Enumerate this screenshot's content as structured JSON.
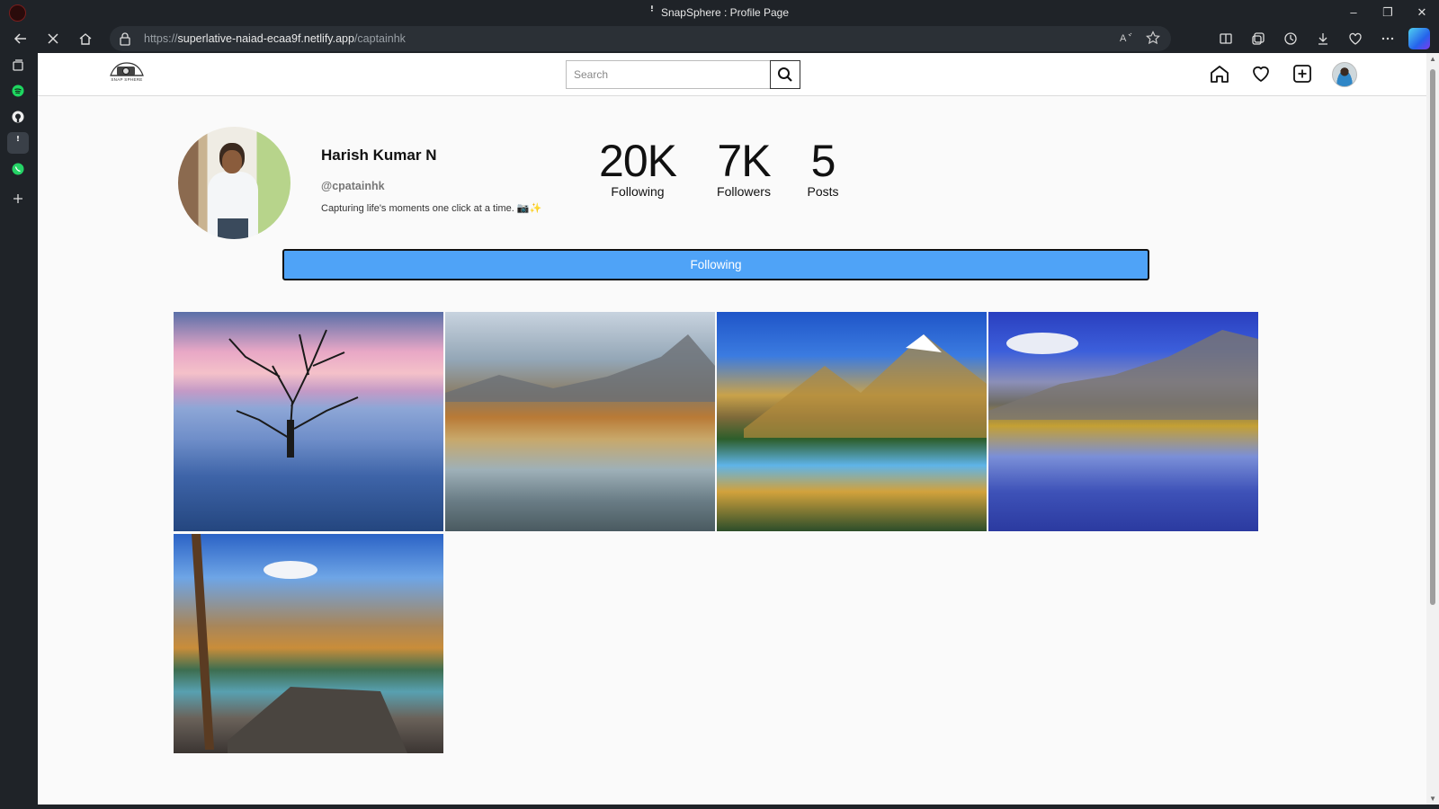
{
  "browser": {
    "window_title": "SnapSphere : Profile Page",
    "url_prefix": "https://",
    "url_host": "superlative-naiad-ecaa9f.netlify.app",
    "url_path": "/captainhk"
  },
  "site": {
    "logo_text": "SNAP SPHERE",
    "search_placeholder": "Search"
  },
  "profile": {
    "name": "Harish Kumar N",
    "handle": "@cpatainhk",
    "bio": "Capturing life's moments one click at a time. 📷✨",
    "stats": [
      {
        "value": "20K",
        "label": "Following"
      },
      {
        "value": "7K",
        "label": "Followers"
      },
      {
        "value": "5",
        "label": "Posts"
      }
    ],
    "follow_button_label": "Following"
  },
  "posts": [
    {
      "subject": "bare tree in sea at sunset"
    },
    {
      "subject": "autumn lake with mountains"
    },
    {
      "subject": "mountain lake with larches"
    },
    {
      "subject": "mountain reflection lake"
    },
    {
      "subject": "larch trees and rocky lake"
    }
  ]
}
